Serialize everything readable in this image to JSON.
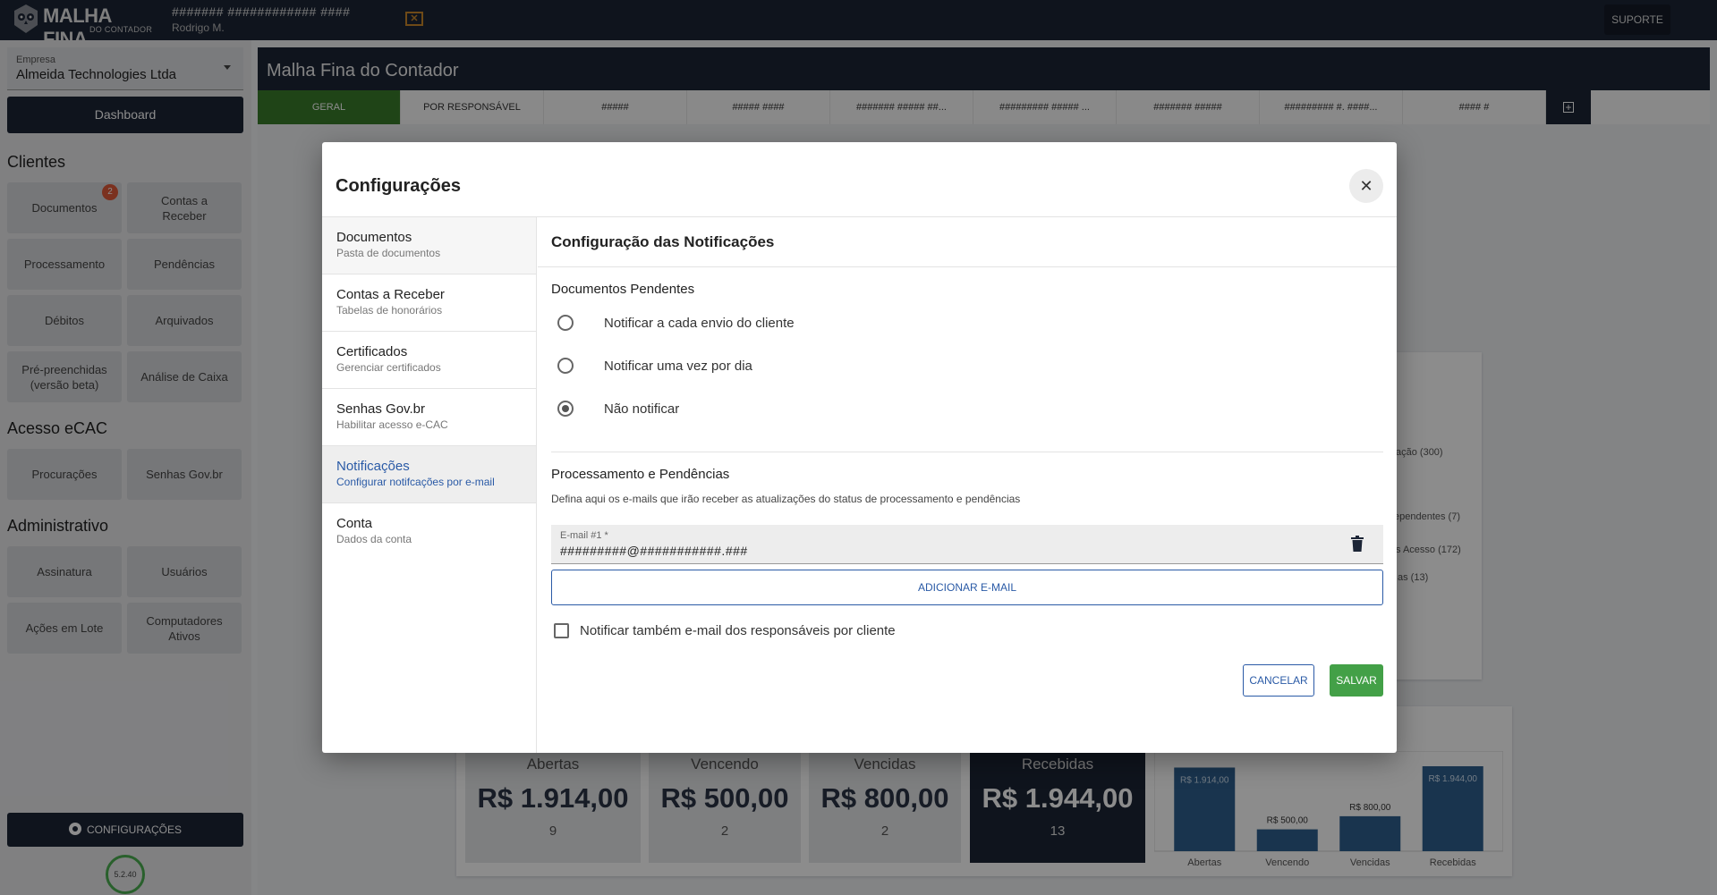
{
  "topbar": {
    "logo_title": "MALHA FINA",
    "logo_subtitle": "DO CONTADOR",
    "company_code": "####### ############ ####",
    "user_name": "Rodrigo M.",
    "support_label": "SUPORTE"
  },
  "sidebar": {
    "company_label": "Empresa",
    "company_value": "Almeida Technologies Ltda",
    "dashboard_label": "Dashboard",
    "clientes_title": "Clientes",
    "clientes": [
      {
        "label": "Documentos",
        "badge": "2"
      },
      {
        "label": "Contas a Receber"
      },
      {
        "label": "Processamento"
      },
      {
        "label": "Pendências"
      },
      {
        "label": "Débitos"
      },
      {
        "label": "Arquivados"
      },
      {
        "label": "Pré-preenchidas (versão beta)"
      },
      {
        "label": "Análise de Caixa"
      }
    ],
    "ecac_title": "Acesso eCAC",
    "ecac": [
      {
        "label": "Procurações"
      },
      {
        "label": "Senhas Gov.br"
      }
    ],
    "admin_title": "Administrativo",
    "admin": [
      {
        "label": "Assinatura"
      },
      {
        "label": "Usuários"
      },
      {
        "label": "Ações em Lote"
      },
      {
        "label": "Computadores Ativos"
      }
    ],
    "config_label": "CONFIGURAÇÕES",
    "version": "5.2.40"
  },
  "main": {
    "title": "Malha Fina do Contador",
    "tabs": [
      "GERAL",
      "POR RESPONSÁVEL",
      "#####",
      "##### ####",
      "####### ##### ##...",
      "######### ##### ...",
      "####### #####",
      "######### #. ####...",
      "#### #"
    ],
    "legend": [
      "ação (300)",
      "ependentes (7)",
      "s Acesso (172)",
      "as (13)"
    ],
    "stats": [
      {
        "label": "Abertas",
        "value": "R$ 1.914,00",
        "count": "9"
      },
      {
        "label": "Vencendo",
        "value": "R$ 500,00",
        "count": "2"
      },
      {
        "label": "Vencidas",
        "value": "R$ 800,00",
        "count": "2"
      },
      {
        "label": "Recebidas",
        "value": "R$ 1.944,00",
        "count": "13"
      }
    ],
    "mini_chart": {
      "categories": [
        "Abertas",
        "Vencendo",
        "Vencidas",
        "Recebidas"
      ],
      "values": [
        1914,
        500,
        800,
        1944
      ],
      "labels": [
        "R$ 1.914,00",
        "R$ 500,00",
        "R$ 800,00",
        "R$ 1.944,00"
      ],
      "bar_color": "#2e5f8e"
    }
  },
  "modal": {
    "title": "Configurações",
    "nav": [
      {
        "title": "Documentos",
        "subtitle": "Pasta de documentos"
      },
      {
        "title": "Contas a Receber",
        "subtitle": "Tabelas de honorários"
      },
      {
        "title": "Certificados",
        "subtitle": "Gerenciar certificados"
      },
      {
        "title": "Senhas Gov.br",
        "subtitle": "Habilitar acesso e-CAC"
      },
      {
        "title": "Notificações",
        "subtitle": "Configurar notifcações por e-mail"
      },
      {
        "title": "Conta",
        "subtitle": "Dados da conta"
      }
    ],
    "content_title": "Configuração das Notificações",
    "pending_group_title": "Documentos Pendentes",
    "radio_options": [
      "Notificar a cada envio do cliente",
      "Notificar uma vez por dia",
      "Não notificar"
    ],
    "selected_option": "Não notificar",
    "processing_group_title": "Processamento e Pendências",
    "help_text": "Defina aqui os e-mails que irão receber as atualizações do status de processamento e pendências",
    "email_label": "E-mail #1 *",
    "email_value": "#########@###########.###",
    "add_email_label": "ADICIONAR E-MAIL",
    "checkbox_label": "Notificar também e-mail dos responsáveis por cliente",
    "cancel_label": "CANCELAR",
    "save_label": "SALVAR"
  },
  "colors": {
    "navy": "#1c2536",
    "active_tab": "#3a7d2b",
    "link_blue": "#2a5aa6",
    "save_green": "#43a047",
    "badge_red": "#e05a3a"
  }
}
